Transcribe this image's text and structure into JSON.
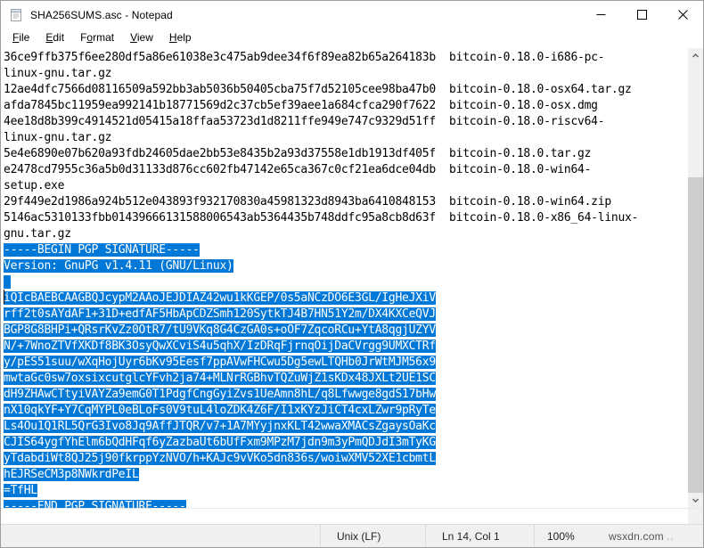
{
  "window": {
    "title": "SHA256SUMS.asc - Notepad",
    "icon": "notepad-icon",
    "controls": {
      "minimize": "minimize-icon",
      "maximize": "maximize-icon",
      "close": "close-icon"
    }
  },
  "menu": {
    "items": [
      {
        "label": "File",
        "accel": "F"
      },
      {
        "label": "Edit",
        "accel": "E"
      },
      {
        "label": "Format",
        "accel": "o"
      },
      {
        "label": "View",
        "accel": "V"
      },
      {
        "label": "Help",
        "accel": "H"
      }
    ]
  },
  "editor": {
    "lines": [
      {
        "text": "36ce9ffb375f6ee280df5a86e61038e3c475ab9dee34f6f89ea82b65a264183b  bitcoin-0.18.0-i686-pc-",
        "selected": false
      },
      {
        "text": "linux-gnu.tar.gz",
        "selected": false
      },
      {
        "text": "12ae4dfc7566d08116509a592bb3ab5036b50405cba75f7d52105cee98ba47b0  bitcoin-0.18.0-osx64.tar.gz",
        "selected": false
      },
      {
        "text": "afda7845bc11959ea992141b18771569d2c37cb5ef39aee1a684cfca290f7622  bitcoin-0.18.0-osx.dmg",
        "selected": false
      },
      {
        "text": "4ee18d8b399c4914521d05415a18ffaa53723d1d8211ffe949e747c9329d51ff  bitcoin-0.18.0-riscv64-",
        "selected": false
      },
      {
        "text": "linux-gnu.tar.gz",
        "selected": false
      },
      {
        "text": "5e4e6890e07b620a93fdb24605dae2bb53e8435b2a93d37558e1db1913df405f  bitcoin-0.18.0.tar.gz",
        "selected": false
      },
      {
        "text": "e2478cd7955c36a5b0d31133d876cc602fb47142e65ca367c0cf21ea6dce04db  bitcoin-0.18.0-win64-",
        "selected": false
      },
      {
        "text": "setup.exe",
        "selected": false
      },
      {
        "text": "29f449e2d1986a924b512e043893f932170830a45981323d8943ba6410848153  bitcoin-0.18.0-win64.zip",
        "selected": false
      },
      {
        "text": "5146ac5310133fbb01439666131588006543ab5364435b748ddfc95a8cb8d63f  bitcoin-0.18.0-x86_64-linux-",
        "selected": false
      },
      {
        "text": "gnu.tar.gz",
        "selected": false
      },
      {
        "text": "-----BEGIN PGP SIGNATURE-----",
        "selected": true
      },
      {
        "text": "Version: GnuPG v1.4.11 (GNU/Linux)",
        "selected": true
      },
      {
        "text": "",
        "selected": true
      },
      {
        "text": "iQIcBAEBCAAGBQJcypM2AAoJEJDIAZ42wu1kKGEP/0s5aNCzDO6E3GL/IgHeJXiV",
        "selected": true
      },
      {
        "text": "rff2t0sAYdAF1+31D+edfAF5HbApCDZSmh120SytkTJ4B7HN51Y2m/DX4KXCeQVJ",
        "selected": true
      },
      {
        "text": "BGP8G8BHPi+QRsrKvZz0OtR7/tU9VKq8G4CzGA0s+oOF7ZqcoRCu+YtA8qgjUZYV",
        "selected": true
      },
      {
        "text": "N/+7WnoZTVfXKDf8BK3OsyQwXCviS4u5qhX/IzDRqFjrnqOijDaCVrgg9UMXCTRf",
        "selected": true
      },
      {
        "text": "y/pES51suu/wXqHojUyr6bKv95Eesf7ppAVwFHCwu5Dg5ewLTQHb0JrWtMJM56x9",
        "selected": true
      },
      {
        "text": "mwtaGc0sw7oxsixcutglcYFvh2ja74+MLNrRGBhvTQZuWjZ1sKDx48JXLt2UE1SC",
        "selected": true
      },
      {
        "text": "dH9ZHAwCTtyiVAYZa9emG0T1PdgfCngGyiZvs1UeAmn8hL/q8Lfwwge8gdS17bHw",
        "selected": true
      },
      {
        "text": "nX10qkYF+Y7CqMYPL0eBLoFs0V9tuL4loZDK4Z6F/I1xKYzJiCT4cxLZwr9pRyTe",
        "selected": true
      },
      {
        "text": "Ls4Ou1Q1RL5QrG3Ivo8Jq9AffJTQR/v7+1A7MYyjnxKLT42wwaXMACsZgaysOaKc",
        "selected": true
      },
      {
        "text": "CJIS64ygfYhElm6bQdHFqf6yZazbaUt6bUfFxm9MPzM7jdn9m3yPmQDJdI3mTyKG",
        "selected": true
      },
      {
        "text": "yTdabdiWt8QJ25j90fkrppYzNVO/h+KAJc9vVKo5dn836s/woiwXMV52XE1cbmtL",
        "selected": true
      },
      {
        "text": "hEJRSeCM3p8NWkrdPeIL",
        "selected": true
      },
      {
        "text": "=TfHL",
        "selected": true
      },
      {
        "text": "-----END PGP SIGNATURE-----",
        "selected": true
      }
    ],
    "selection_color": "#0078d7",
    "selection_text_color": "#ffffff"
  },
  "statusbar": {
    "encoding": "Unix (LF)",
    "position": "Ln 14, Col 1",
    "zoom": "100%",
    "watermark": "wsxdn.com"
  }
}
